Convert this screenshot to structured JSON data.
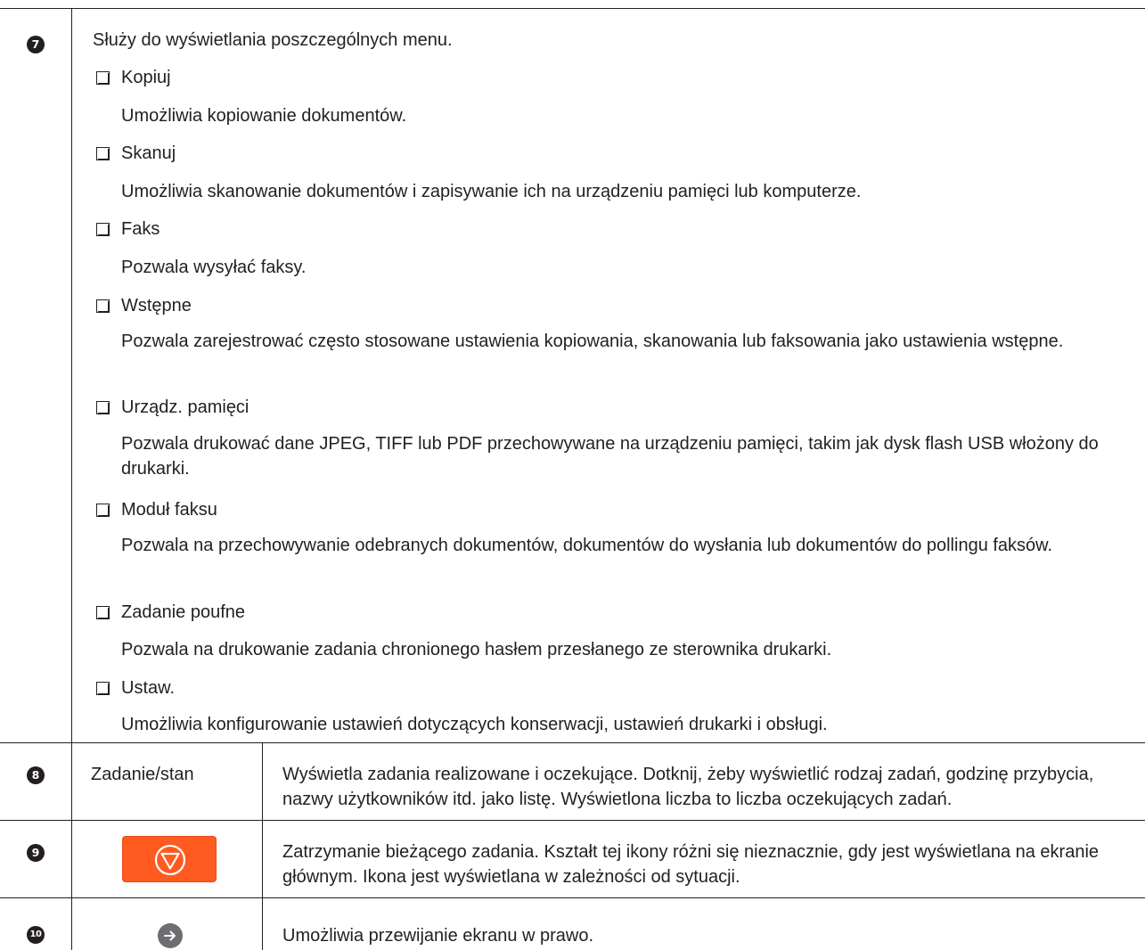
{
  "row7": {
    "number": "7",
    "intro": "Służy do wyświetlania poszczególnych menu.",
    "items": [
      {
        "label": "Kopiuj",
        "desc": "Umożliwia kopiowanie dokumentów."
      },
      {
        "label": "Skanuj",
        "desc": "Umożliwia skanowanie dokumentów i zapisywanie ich na urządzeniu pamięci lub komputerze."
      },
      {
        "label": "Faks",
        "desc": "Pozwala wysyłać faksy."
      },
      {
        "label": "Wstępne",
        "desc": "Pozwala zarejestrować często stosowane ustawienia kopiowania, skanowania lub faksowania jako ustawienia wstępne."
      },
      {
        "label": "Urządz. pamięci",
        "desc": "Pozwala drukować dane JPEG, TIFF lub PDF przechowywane na urządzeniu pamięci, takim jak dysk flash USB włożony do drukarki."
      },
      {
        "label": "Moduł faksu",
        "desc": "Pozwala na przechowywanie odebranych dokumentów, dokumentów do wysłania lub dokumentów do pollingu faksów."
      },
      {
        "label": "Zadanie poufne",
        "desc": "Pozwala na drukowanie zadania chronionego hasłem przesłanego ze sterownika drukarki."
      },
      {
        "label": "Ustaw.",
        "desc": "Umożliwia konfigurowanie ustawień dotyczących konserwacji, ustawień drukarki i obsługi."
      }
    ]
  },
  "row8": {
    "number": "8",
    "name": "Zadanie/stan",
    "desc": "Wyświetla zadania realizowane i oczekujące. Dotknij, żeby wyświetlić rodzaj zadań, godzinę przybycia, nazwy użytkowników itd. jako listę. Wyświetlona liczba to liczba oczekujących zadań."
  },
  "row9": {
    "number": "9",
    "icon": "stop-icon",
    "icon_color": "#ff5a1f",
    "desc": "Zatrzymanie bieżącego zadania. Kształt tej ikony różni się nieznacznie, gdy jest wyświetlana na ekranie głównym. Ikona jest wyświetlana w zależności od sytuacji."
  },
  "row10": {
    "number": "10",
    "icon": "arrow-right-icon",
    "icon_color": "#6d6e71",
    "desc": "Umożliwia przewijanie ekranu w prawo."
  }
}
